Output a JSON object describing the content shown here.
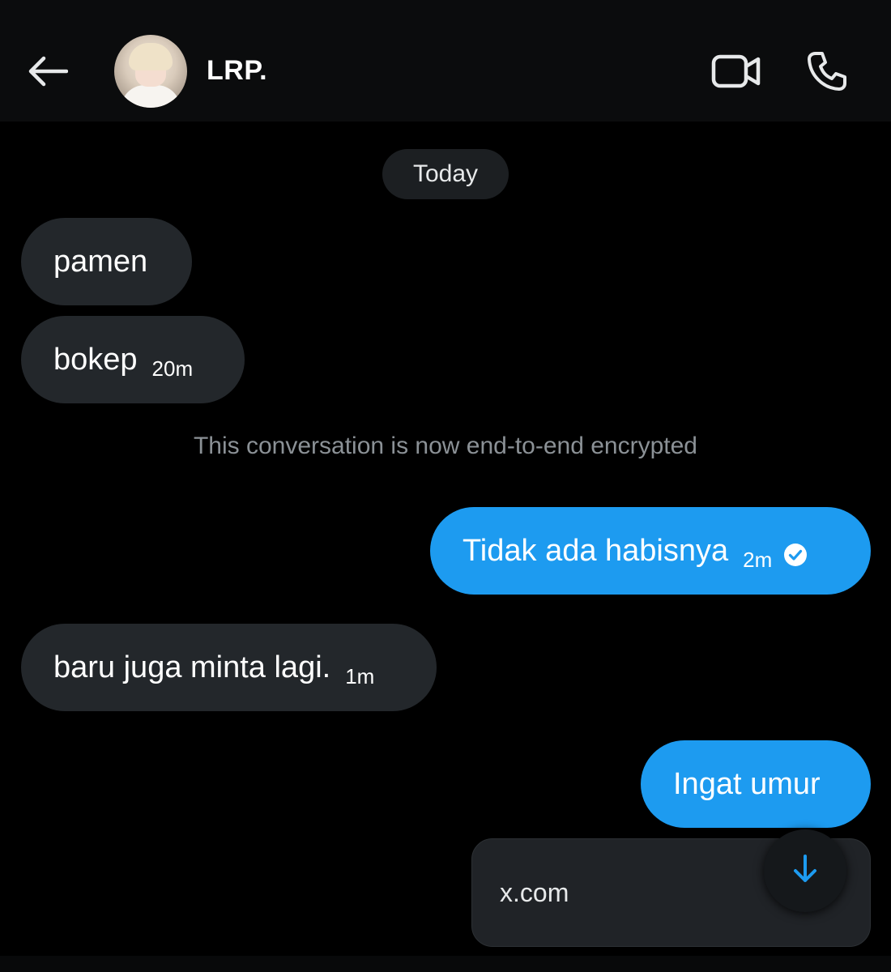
{
  "header": {
    "contact_name": "LRP.",
    "back_icon": "arrow-left-icon",
    "video_icon": "video-camera-icon",
    "call_icon": "phone-icon"
  },
  "date_separator": "Today",
  "encrypted_notice": "This conversation is now end-to-end encrypted",
  "messages": [
    {
      "direction": "incoming",
      "text": "pamen",
      "time": ""
    },
    {
      "direction": "incoming",
      "text": "bokep",
      "time": "20m"
    },
    {
      "direction": "outgoing",
      "text": "Tidak ada habisnya",
      "time": "2m",
      "status": "read"
    },
    {
      "direction": "incoming",
      "text": "baru juga minta lagi.",
      "time": "1m"
    },
    {
      "direction": "outgoing",
      "text": "Ingat umur",
      "time": ""
    }
  ],
  "link_preview": {
    "domain": "x.com"
  },
  "colors": {
    "background": "#000000",
    "incoming_bubble": "#23272b",
    "outgoing_bubble": "#1d9bf0",
    "accent": "#1d9bf0",
    "muted_text": "#8b9196"
  }
}
